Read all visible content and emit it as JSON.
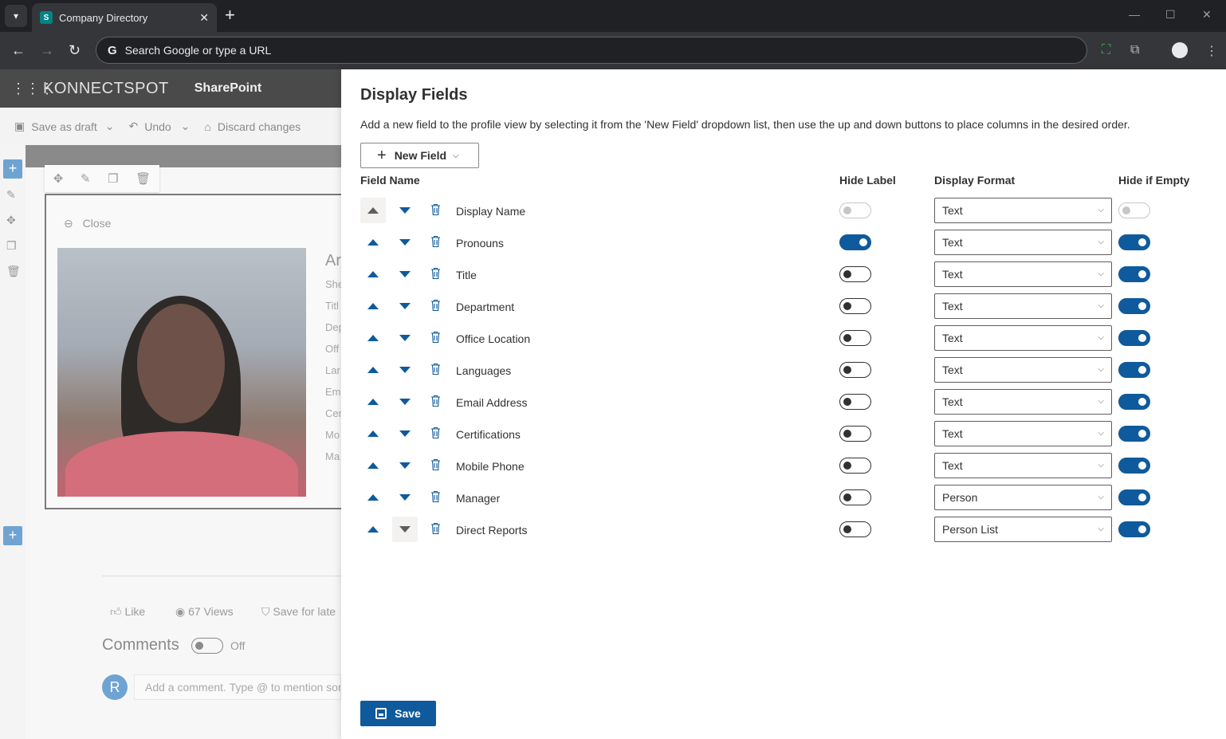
{
  "browser": {
    "tab_title": "Company Directory",
    "favicon_text": "S",
    "omnibox_placeholder": "Search Google or type a URL",
    "new_tab": "+",
    "tab_close": "✕",
    "minimize": "—",
    "maximize": "☐",
    "close": "✕"
  },
  "sharepoint": {
    "logo": "KONNECTSPOT",
    "site_name": "SharePoint",
    "commands": {
      "save_draft": "Save as draft",
      "undo": "Undo",
      "discard": "Discard changes"
    },
    "close_label": "Close",
    "profile_name": "Ar",
    "profile_fields": [
      "She",
      "Titl",
      "Dep",
      "Off",
      "Lar",
      "Em",
      "Cer",
      "Mo",
      "Ma"
    ],
    "like": "Like",
    "views": "67 Views",
    "save_later": "Save for late",
    "comments_title": "Comments",
    "comments_toggle": "Off",
    "avatar_letter": "R",
    "comment_placeholder": "Add a comment. Type @ to mention sor"
  },
  "panel": {
    "title": "Display Fields",
    "description": "Add a new field to the profile view by selecting it from the 'New Field' dropdown list, then use the up and down buttons to place columns in the desired order.",
    "new_field_label": "New Field",
    "columns": {
      "field_name": "Field Name",
      "hide_label": "Hide Label",
      "display_format": "Display Format",
      "hide_if_empty": "Hide if Empty"
    },
    "rows": [
      {
        "name": "Display Name",
        "hide_label": false,
        "hide_label_disabled": true,
        "format": "Text",
        "hide_if_empty": false,
        "hide_if_empty_disabled": true
      },
      {
        "name": "Pronouns",
        "hide_label": true,
        "format": "Text",
        "hide_if_empty": true
      },
      {
        "name": "Title",
        "hide_label": false,
        "format": "Text",
        "hide_if_empty": true
      },
      {
        "name": "Department",
        "hide_label": false,
        "format": "Text",
        "hide_if_empty": true
      },
      {
        "name": "Office Location",
        "hide_label": false,
        "format": "Text",
        "hide_if_empty": true
      },
      {
        "name": "Languages",
        "hide_label": false,
        "format": "Text",
        "hide_if_empty": true
      },
      {
        "name": "Email Address",
        "hide_label": false,
        "format": "Text",
        "hide_if_empty": true
      },
      {
        "name": "Certifications",
        "hide_label": false,
        "format": "Text",
        "hide_if_empty": true
      },
      {
        "name": "Mobile Phone",
        "hide_label": false,
        "format": "Text",
        "hide_if_empty": true
      },
      {
        "name": "Manager",
        "hide_label": false,
        "format": "Person",
        "hide_if_empty": true
      },
      {
        "name": "Direct Reports",
        "hide_label": false,
        "format": "Person List",
        "hide_if_empty": true
      }
    ],
    "save_label": "Save"
  },
  "colors": {
    "accent": "#0f5a9c",
    "chrome_dark": "#202124",
    "chrome_mid": "#35363a"
  }
}
